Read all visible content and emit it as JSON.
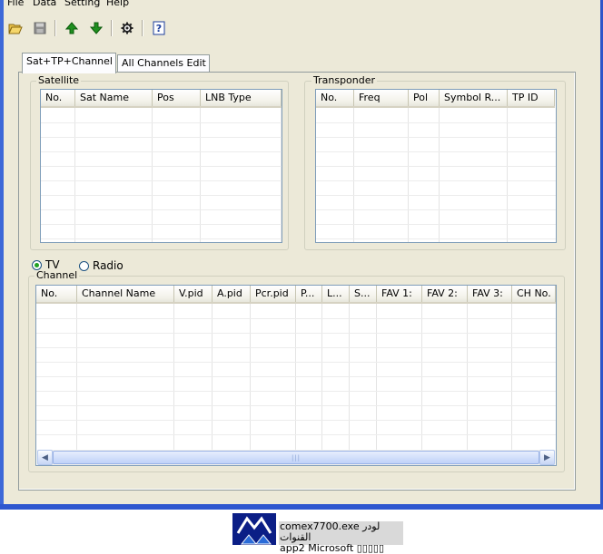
{
  "menu": [
    "File",
    "Data",
    "Setting",
    "Help"
  ],
  "toolbar": {
    "open": "folder-open-icon",
    "save": "floppy-save-icon",
    "up": "arrow-up-icon",
    "down": "arrow-down-icon",
    "settings": "gear-icon",
    "help": "help-icon"
  },
  "tabs": [
    "Sat+TP+Channel",
    "All Channels Edit"
  ],
  "satellite": {
    "label": "Satellite",
    "columns": [
      "No.",
      "Sat Name",
      "Pos",
      "LNB Type"
    ]
  },
  "transponder": {
    "label": "Transponder",
    "columns": [
      "No.",
      "Freq",
      "Pol",
      "Symbol R...",
      "TP ID"
    ]
  },
  "mode": {
    "tv": "TV",
    "radio": "Radio",
    "selected": "TV"
  },
  "channel": {
    "label": "Channel",
    "columns": [
      "No.",
      "Channel Name",
      "V.pid",
      "A.pid",
      "Pcr.pid",
      "P...",
      "L...",
      "S...",
      "FAV 1:",
      "FAV 2:",
      "FAV 3:",
      "CH No."
    ]
  },
  "tooltip": {
    "line1": "comex7700.exe لودر القنوات",
    "line2": "app2 Microsoft ▯▯▯▯▯"
  },
  "colors": {
    "window_bg": "#ece9d8",
    "frame_blue": "#3d68d8",
    "arrow_green": "#1f8f1f"
  }
}
